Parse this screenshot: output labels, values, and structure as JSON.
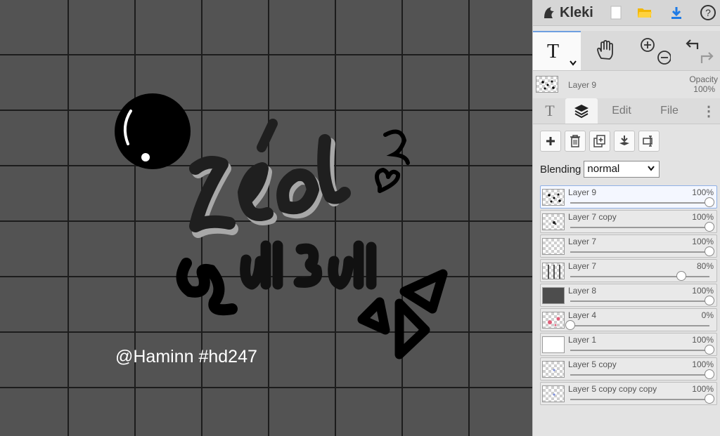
{
  "app": {
    "name": "Kleki"
  },
  "canvas": {
    "watermark": "@Haminn #hd247",
    "artwork_text": "zéo suisu"
  },
  "topbar": {
    "new_icon": "new-file-icon",
    "open_icon": "folder-open-icon",
    "save_icon": "download-icon",
    "help_label": "?"
  },
  "tools": {
    "text_tool": "T",
    "hand_icon": "hand-icon",
    "zoom_in_icon": "zoom-in-icon",
    "zoom_out_icon": "zoom-out-icon",
    "undo_icon": "undo-icon",
    "redo_icon": "redo-icon"
  },
  "current_layer": {
    "name": "Layer 9",
    "opacity_label": "Opacity",
    "opacity_value": "100%"
  },
  "tabs": [
    {
      "label": "T"
    },
    {
      "label": "layers"
    },
    {
      "label": "Edit"
    },
    {
      "label": "File"
    },
    {
      "label": "⋮"
    }
  ],
  "blending": {
    "label": "Blending",
    "value": "normal"
  },
  "layers": [
    {
      "name": "Layer 9",
      "opacity": "100%",
      "level": 1.0,
      "selected": true,
      "thumb": "dots"
    },
    {
      "name": "Layer 7 copy",
      "opacity": "100%",
      "level": 1.0,
      "selected": false,
      "thumb": "speck"
    },
    {
      "name": "Layer 7",
      "opacity": "100%",
      "level": 1.0,
      "selected": false,
      "thumb": "empty"
    },
    {
      "name": "Layer 7",
      "opacity": "80%",
      "level": 0.8,
      "selected": false,
      "thumb": "grid"
    },
    {
      "name": "Layer 8",
      "opacity": "100%",
      "level": 1.0,
      "selected": false,
      "thumb": "gray"
    },
    {
      "name": "Layer 4",
      "opacity": "0%",
      "level": 0.0,
      "selected": false,
      "thumb": "pink"
    },
    {
      "name": "Layer 1",
      "opacity": "100%",
      "level": 1.0,
      "selected": false,
      "thumb": "white"
    },
    {
      "name": "Layer 5 copy",
      "opacity": "100%",
      "level": 1.0,
      "selected": false,
      "thumb": "blue"
    },
    {
      "name": "Layer 5 copy copy copy",
      "opacity": "100%",
      "level": 1.0,
      "selected": false,
      "thumb": "blue"
    }
  ],
  "colors": {
    "accent": "#6d9fe0",
    "canvas_bg": "#535353",
    "grid": "#1a1a1a"
  }
}
